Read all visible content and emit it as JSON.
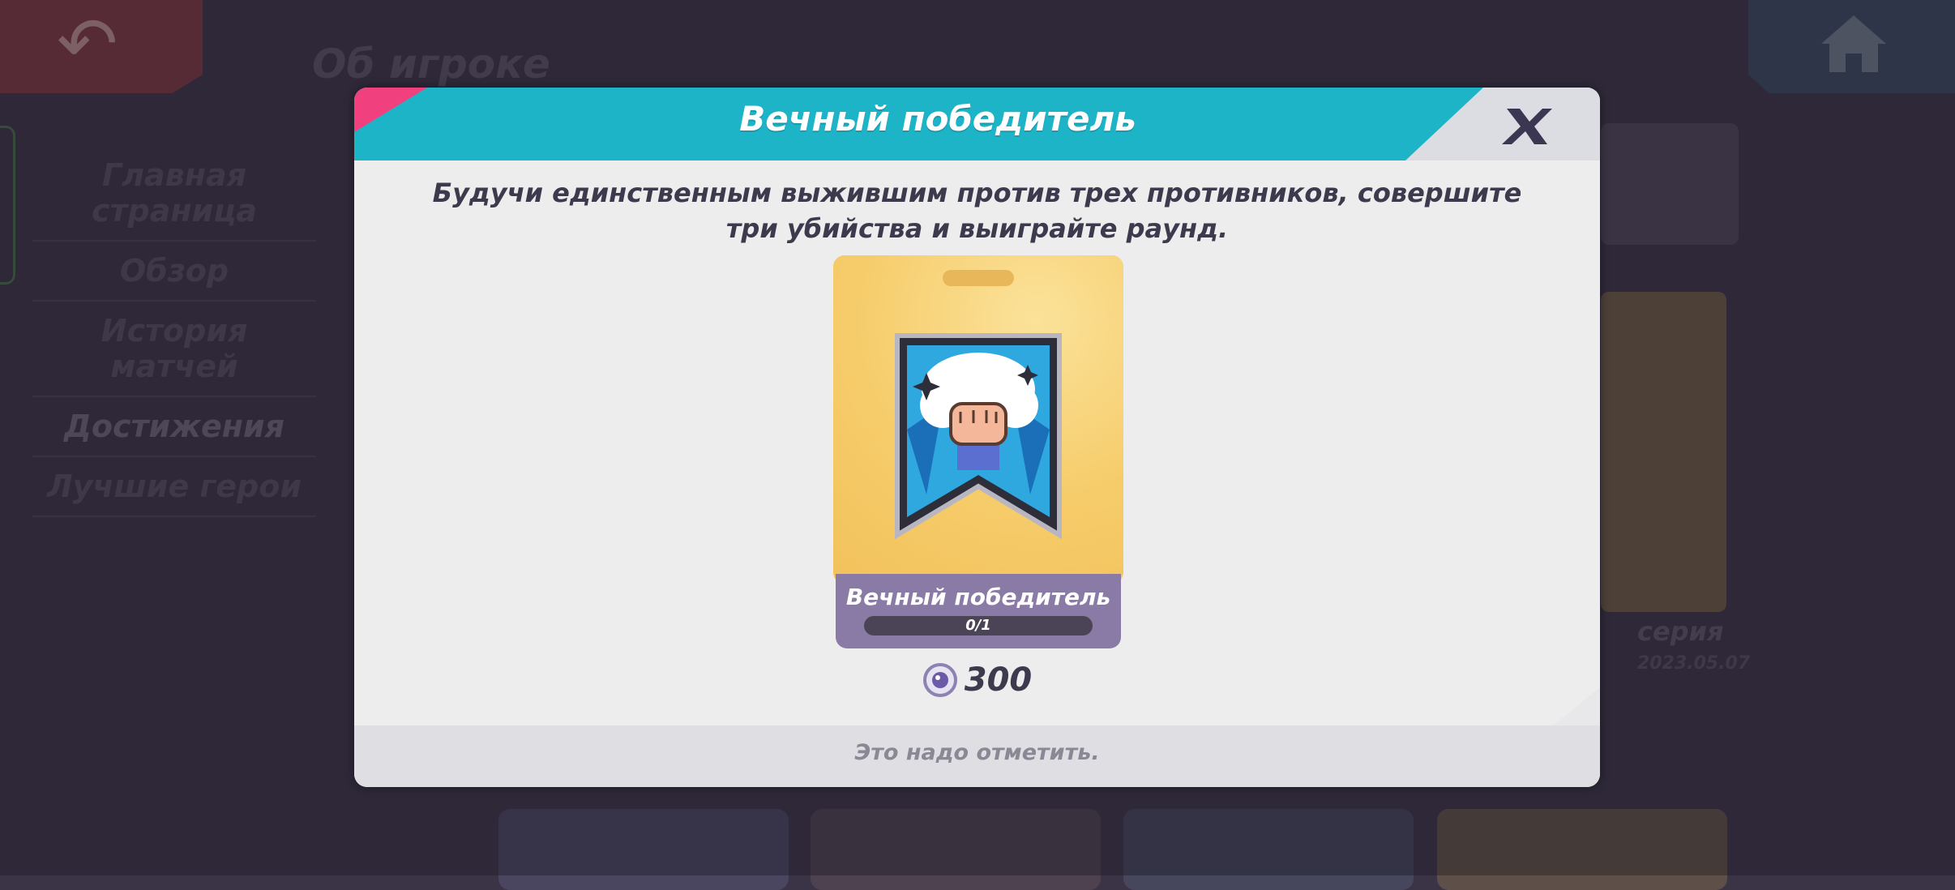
{
  "background": {
    "heading": "Об игроке",
    "menu": [
      {
        "label": "Главная страница"
      },
      {
        "label": "Обзор"
      },
      {
        "label": "История матчей"
      },
      {
        "label": "Достижения"
      },
      {
        "label": "Лучшие герои"
      }
    ],
    "right_card_caption": "серия",
    "right_card_date": "2023.05.07"
  },
  "dialog": {
    "title": "Вечный победитель",
    "description": "Будучи единственным выжившим против трех противников, совершите три убийства и выиграйте раунд.",
    "achievement": {
      "name": "Вечный победитель",
      "progress_text": "0/1",
      "progress_current": 0,
      "progress_total": 1,
      "reward_amount": "300",
      "reward_icon": "gem-icon",
      "badge_icon": "fist-banner-icon"
    },
    "footer_text": "Это надо отметить."
  },
  "colors": {
    "header_teal": "#1eb4c8",
    "header_pink": "#f0407e",
    "card_gold": "#f7d170",
    "card_footer_purple": "#8a7aa6"
  }
}
